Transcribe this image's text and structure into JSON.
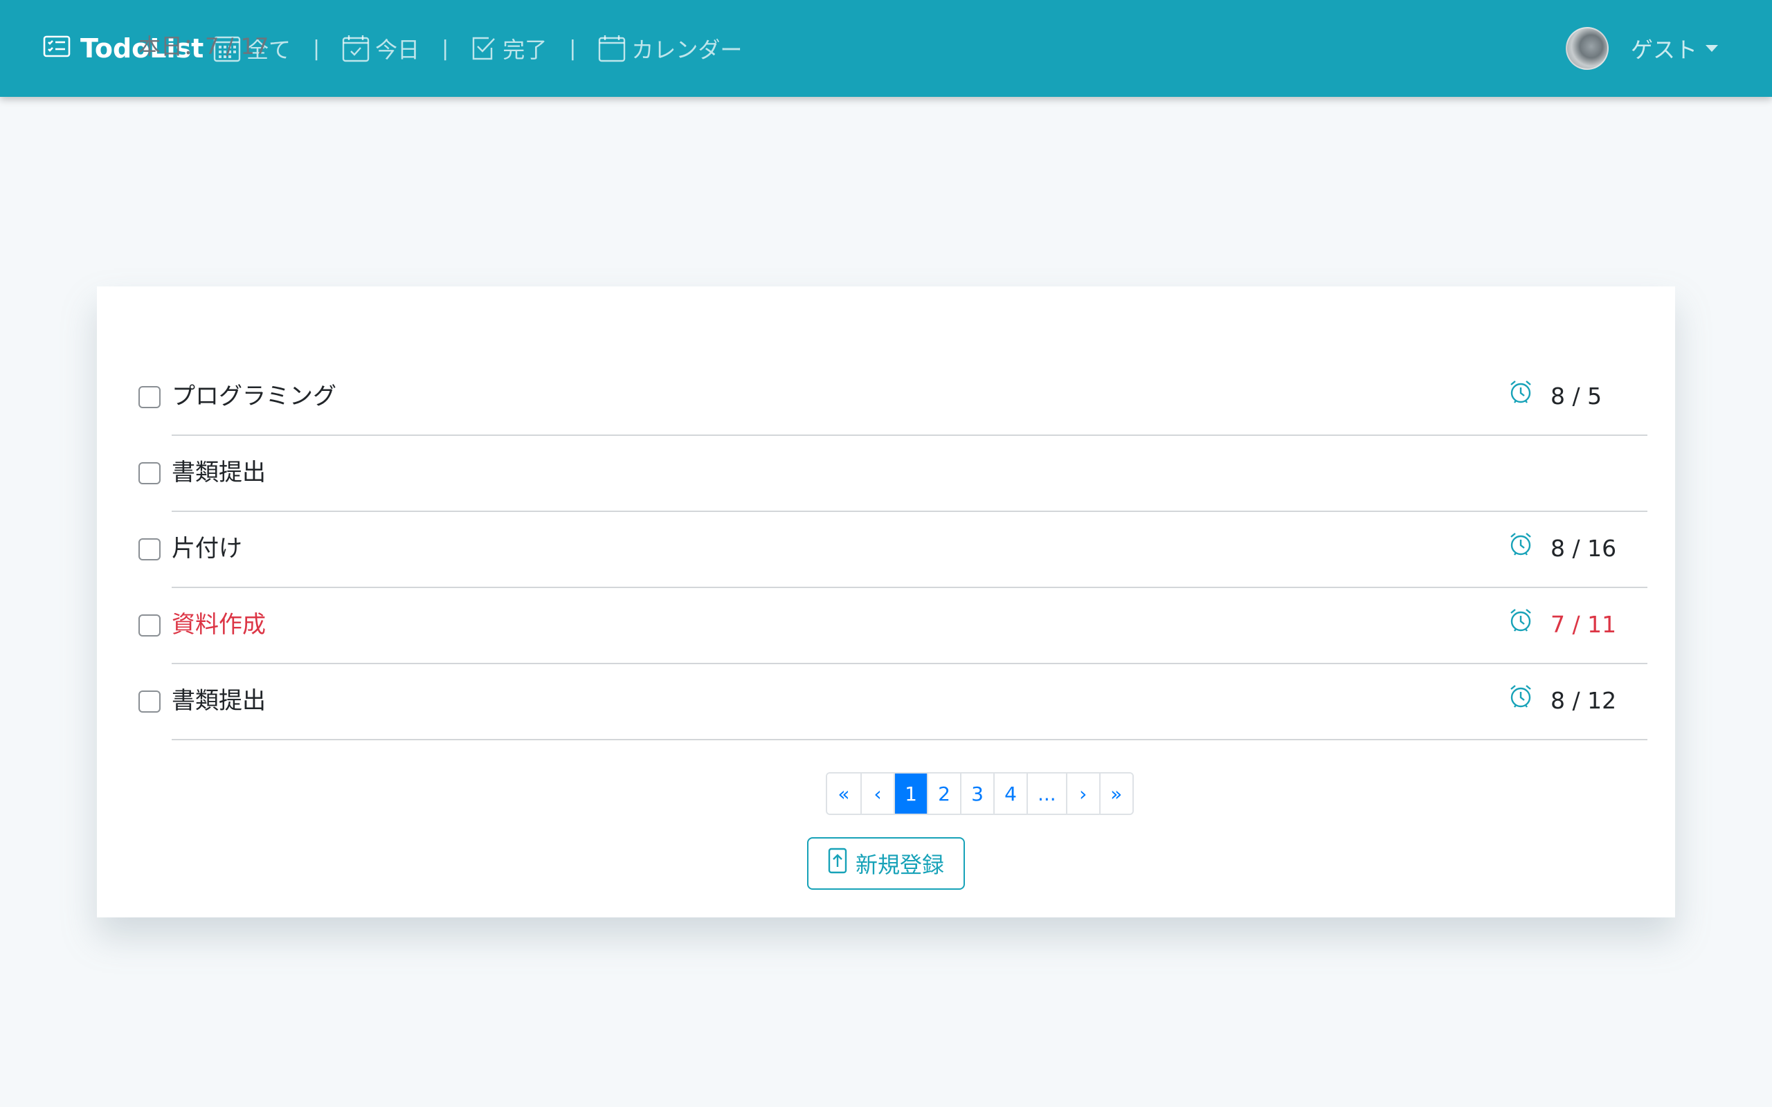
{
  "navbar": {
    "brand": "TodoList",
    "links": [
      {
        "label": "全て",
        "icon": "grid-calendar-icon"
      },
      {
        "label": "今日",
        "icon": "calendar-check-icon"
      },
      {
        "label": "完了",
        "icon": "check-square-icon"
      },
      {
        "label": "カレンダー",
        "icon": "calendar-icon"
      }
    ],
    "separator": "|",
    "user_name": "ゲスト"
  },
  "today": {
    "label": "本日：7 / 17"
  },
  "todos": [
    {
      "title": "プログラミング",
      "due": "8 / 5",
      "has_due": true,
      "overdue": false
    },
    {
      "title": "書類提出",
      "due": "",
      "has_due": false,
      "overdue": false
    },
    {
      "title": "片付け",
      "due": "8 / 16",
      "has_due": true,
      "overdue": false
    },
    {
      "title": "資料作成",
      "due": "7 / 11",
      "has_due": true,
      "overdue": true
    },
    {
      "title": "書類提出",
      "due": "8 / 12",
      "has_due": true,
      "overdue": false
    }
  ],
  "pagination": {
    "first": "«",
    "prev": "‹",
    "pages": [
      "1",
      "2",
      "3",
      "4"
    ],
    "active_page": "1",
    "ellipsis": "...",
    "next": "›",
    "last": "»"
  },
  "new_button": {
    "label": "新規登録",
    "icon": "file-upload-icon"
  },
  "colors": {
    "primary": "#17a2b8",
    "link": "#007bff",
    "danger": "#dc3545",
    "background": "#f5f8fa"
  }
}
